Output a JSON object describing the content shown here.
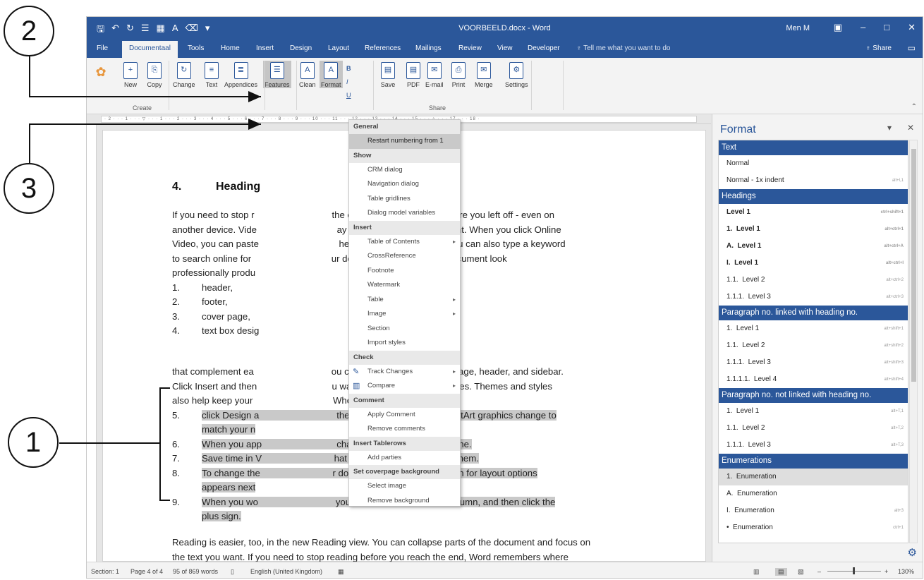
{
  "callouts": {
    "c1": "1",
    "c2": "2",
    "c3": "3"
  },
  "titlebar": {
    "qat": [
      "🖫",
      "↶",
      "↻",
      "☰",
      "▦",
      "A",
      "⌫",
      "▾"
    ],
    "doc_title": "VOORBEELD.docx - Word",
    "user": "Men M",
    "ribbon_options": "▣",
    "minimize": "–",
    "maximize": "□",
    "close": "✕"
  },
  "tabs": [
    "File",
    "Documentaal",
    "Tools",
    "Home",
    "Insert",
    "Design",
    "Layout",
    "References",
    "Mailings",
    "Review",
    "View",
    "Developer"
  ],
  "tell_me": "♀ Tell me what you want to do",
  "share": "♀ Share",
  "ribbon": {
    "buttons": [
      {
        "label": "New",
        "icon": "+"
      },
      {
        "label": "Copy",
        "icon": "⎘"
      },
      {
        "label": "Change",
        "icon": "↻"
      },
      {
        "label": "Text",
        "icon": "≡"
      },
      {
        "label": "Appendices",
        "icon": "≣"
      },
      {
        "label": "Features",
        "icon": "☰"
      },
      {
        "label": "Clean",
        "icon": "A"
      },
      {
        "label": "Format",
        "icon": "A"
      },
      {
        "label": "Save",
        "icon": "▤"
      },
      {
        "label": "PDF",
        "icon": "▤"
      },
      {
        "label": "E-mail",
        "icon": "✉"
      },
      {
        "label": "Print",
        "icon": "⎙"
      },
      {
        "label": "Merge",
        "icon": "✉"
      },
      {
        "label": "Settings",
        "icon": "⚙"
      }
    ],
    "groups": {
      "create": "Create",
      "share": "Share"
    },
    "small_b": "B",
    "small_i": "I",
    "small_u": "U"
  },
  "ruler": {
    "ticks": "· 2 · · · 1 · · · ▽ · · · 1 · · · 2 · · · 3 · · · 4 · · · 5 · · · 6 · · · 7 · · · 8 · · · 9 · · · 10 · · · 11 · · · 12 · · · 13 · · · 14 · · · 15 · · · △ · · · 17 · · · 18 ·"
  },
  "document": {
    "heading_num": "4.",
    "heading_text": "Heading",
    "p1": [
      "If you need to stop r                              the end, Word remembers where you left off - even on",
      "another device. Vide                               ay to help you prove your point. When you click Online",
      "Video, you can paste                               he video you want to add. You can also type a keyword",
      "to search online for                               ur document. To make your document look",
      "professionally produ"
    ],
    "list_a": [
      {
        "n": "1.",
        "t": "header,"
      },
      {
        "n": "2.",
        "t": "footer,"
      },
      {
        "n": "3.",
        "t": "cover page,"
      },
      {
        "n": "4.",
        "t": "text box desig"
      }
    ],
    "p2": [
      "that complement ea                              ou can add a matching cover page, header, and sidebar.",
      "Click Insert and then                             u want from the different galleries. Themes and styles",
      "also help keep your                               When you:"
    ],
    "list_b": [
      {
        "n": "5.",
        "t": "click Design a                              the pictures, charts, and SmartArt graphics change to"
      },
      {
        "n": "",
        "t": "match your n"
      },
      {
        "n": "6.",
        "t": "When you app                             change to match the new theme."
      },
      {
        "n": "7.",
        "t": "Save time in V                            hat show up where you need them."
      },
      {
        "n": "8.",
        "t": "To change the                            r document, click it and a button for layout options"
      },
      {
        "n": "",
        "t": "appears next"
      },
      {
        "n": "9.",
        "t": "When you wo                              you want to add a row or a column, and then click the"
      },
      {
        "n": "",
        "t": "plus sign."
      }
    ],
    "p3": [
      "Reading is easier, too, in the new Reading view. You can collapse parts of the document and focus on",
      "the text you want. If you need to stop reading before you reach the end, Word remembers where",
      "you left off - even on another device."
    ]
  },
  "menu": [
    {
      "type": "head",
      "label": "General"
    },
    {
      "type": "item",
      "label": "Restart numbering from 1",
      "hover": true
    },
    {
      "type": "head",
      "label": "Show"
    },
    {
      "type": "item",
      "label": "CRM dialog"
    },
    {
      "type": "item",
      "label": "Navigation dialog"
    },
    {
      "type": "item",
      "label": "Table gridlines"
    },
    {
      "type": "item",
      "label": "Dialog model variables"
    },
    {
      "type": "head",
      "label": "Insert"
    },
    {
      "type": "item",
      "label": "Table of Contents",
      "arrow": "▸"
    },
    {
      "type": "item",
      "label": "CrossReference"
    },
    {
      "type": "item",
      "label": "Footnote"
    },
    {
      "type": "item",
      "label": "Watermark"
    },
    {
      "type": "item",
      "label": "Table",
      "arrow": "▸"
    },
    {
      "type": "item",
      "label": "Image",
      "arrow": "▸"
    },
    {
      "type": "item",
      "label": "Section"
    },
    {
      "type": "item",
      "label": "Import styles"
    },
    {
      "type": "head",
      "label": "Check"
    },
    {
      "type": "item",
      "label": "Track Changes",
      "arrow": "▸",
      "icon": "✎"
    },
    {
      "type": "item",
      "label": "Compare",
      "arrow": "▸",
      "icon": "▥"
    },
    {
      "type": "head",
      "label": "Comment"
    },
    {
      "type": "item",
      "label": "Apply Comment"
    },
    {
      "type": "item",
      "label": "Remove comments"
    },
    {
      "type": "head",
      "label": "Insert Tablerows"
    },
    {
      "type": "item",
      "label": "Add parties"
    },
    {
      "type": "head",
      "label": "Set coverpage background"
    },
    {
      "type": "item",
      "label": "Select image"
    },
    {
      "type": "item",
      "label": "Remove background"
    }
  ],
  "format_pane": {
    "title": "Format",
    "sections": [
      {
        "head": "Text",
        "items": [
          {
            "label": "Normal",
            "sc": ""
          },
          {
            "label": "Normal - 1x indent",
            "sc": "alt+l,1"
          }
        ]
      },
      {
        "head": "Headings",
        "items": [
          {
            "label": "Level 1",
            "sc": "ctrl+shift+1",
            "bold": true
          },
          {
            "label": "1.  Level 1",
            "sc": "alt+ctrl+1",
            "bold": true
          },
          {
            "label": "A.  Level 1",
            "sc": "alt+ctrl+A",
            "bold": true
          },
          {
            "label": "I.  Level 1",
            "sc": "alt+ctrl+I",
            "bold": true
          },
          {
            "label": "1.1.  Level 2",
            "sc": "alt+ctrl+2"
          },
          {
            "label": "1.1.1.  Level 3",
            "sc": "alt+ctrl+3"
          }
        ]
      },
      {
        "head": "Paragraph no. linked with heading no.",
        "items": [
          {
            "label": "1.  Level 1",
            "sc": "alt+shift+1"
          },
          {
            "label": "1.1.  Level 2",
            "sc": "alt+shift+2"
          },
          {
            "label": "1.1.1.  Level 3",
            "sc": "alt+shift+3"
          },
          {
            "label": "1.1.1.1.  Level 4",
            "sc": "alt+shift+4"
          }
        ]
      },
      {
        "head": "Paragraph no. not linked with heading no.",
        "items": [
          {
            "label": "1.  Level 1",
            "sc": "alt+T,1"
          },
          {
            "label": "1.1.  Level 2",
            "sc": "alt+T,2"
          },
          {
            "label": "1.1.1.  Level 3",
            "sc": "alt+T,3"
          }
        ]
      },
      {
        "head": "Enumerations",
        "items": [
          {
            "label": "1.  Enumeration",
            "sc": "",
            "selected": true
          },
          {
            "label": "A.  Enumeration",
            "sc": ""
          },
          {
            "label": "I.  Enumeration",
            "sc": "alt+3"
          },
          {
            "label": "•  Enumeration",
            "sc": "ctrl+1"
          }
        ]
      }
    ]
  },
  "statusbar": {
    "section": "Section: 1",
    "page": "Page 4 of 4",
    "words": "95 of 869 words",
    "language": "English (United Kingdom)",
    "zoom": "130%",
    "minus": "–",
    "plus": "+"
  },
  "colors": {
    "brand": "#2b579a",
    "highlight": "#c9c9c9"
  }
}
